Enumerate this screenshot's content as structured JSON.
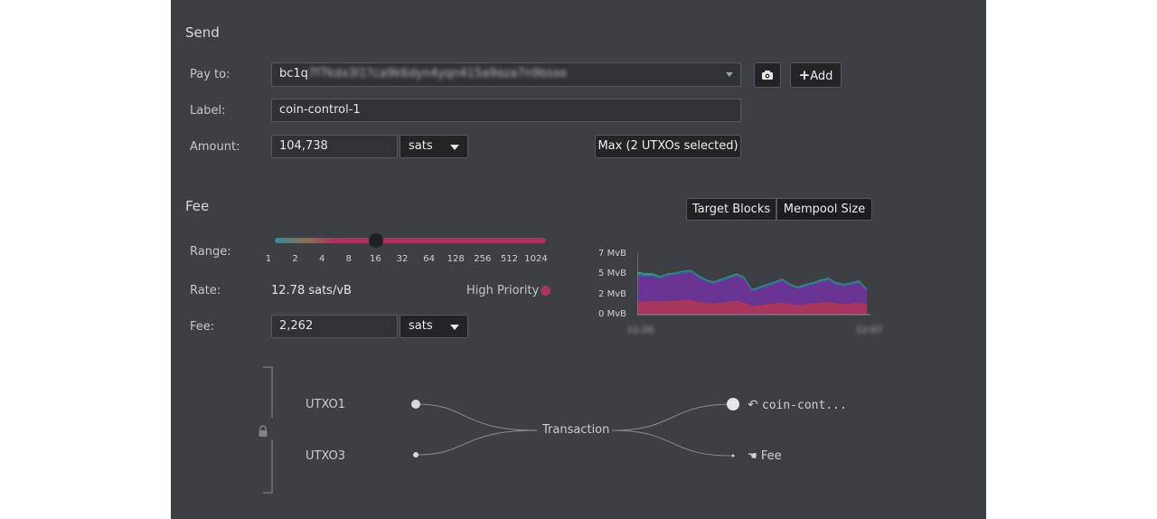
{
  "send": {
    "title": "Send",
    "pay_to_label": "Pay to:",
    "pay_to_prefix": "bc1q",
    "pay_to_obscured": "7f7kdx3l1?ca9k6dyn4yqn415a9aza7n9bsxe",
    "add_label": "Add",
    "label_label": "Label:",
    "label_value": "coin-control-1",
    "amount_label": "Amount:",
    "amount_value": "104,738",
    "amount_unit": "sats",
    "max_label": "Max (2 UTXOs selected)"
  },
  "fee": {
    "title": "Fee",
    "range_label": "Range:",
    "ticks": [
      "1",
      "2",
      "4",
      "8",
      "16",
      "32",
      "64",
      "128",
      "256",
      "512",
      "1024"
    ],
    "slider_position": 0.37,
    "rate_label": "Rate:",
    "rate_value": "12.78 sats/vB",
    "priority_label": "High Priority",
    "fee_label": "Fee:",
    "fee_value": "2,262",
    "fee_unit": "sats"
  },
  "chart_toggle": {
    "target_blocks": "Target Blocks",
    "mempool_size": "Mempool Size",
    "active": "mempool_size"
  },
  "chart_data": {
    "type": "area",
    "title": "",
    "xlabel": "",
    "ylabel": "",
    "y_ticks": [
      "7 MvB",
      "5 MvB",
      "2 MvB",
      "0 MvB"
    ],
    "ylim": [
      0,
      7
    ],
    "x_tick_labels_obscured": [
      "11:20",
      "12:07"
    ],
    "x": [
      0,
      1,
      2,
      3,
      4,
      5,
      6,
      7,
      8,
      9,
      10,
      11,
      12,
      13,
      14,
      15,
      16,
      17,
      18,
      19,
      20,
      21,
      22,
      23,
      24,
      25,
      26,
      27,
      28,
      29,
      30
    ],
    "series": [
      {
        "name": "",
        "color": "#a8355f",
        "values": [
          1.5,
          1.5,
          1.6,
          1.5,
          1.6,
          1.6,
          1.7,
          1.7,
          1.5,
          1.4,
          1.3,
          1.4,
          1.5,
          1.6,
          1.4,
          1.0,
          1.1,
          1.2,
          1.3,
          1.4,
          1.2,
          1.1,
          1.2,
          1.3,
          1.4,
          1.5,
          1.3,
          1.2,
          1.3,
          1.4,
          1.2
        ]
      },
      {
        "name": "",
        "color": "#6a3494",
        "values": [
          2.9,
          2.8,
          2.7,
          2.6,
          2.8,
          2.9,
          3.0,
          3.1,
          2.7,
          2.3,
          2.2,
          2.4,
          2.6,
          2.8,
          2.6,
          1.6,
          1.8,
          2.0,
          2.2,
          2.4,
          2.0,
          1.8,
          2.0,
          2.1,
          2.3,
          2.4,
          2.1,
          2.0,
          2.1,
          2.2,
          1.5
        ]
      },
      {
        "name": "",
        "color": "#3d62a8",
        "values": [
          0.3,
          0.2,
          0.2,
          0.2,
          0.2,
          0.2,
          0.2,
          0.2,
          0.2,
          0.2,
          0.2,
          0.2,
          0.2,
          0.2,
          0.2,
          0.2,
          0.2,
          0.2,
          0.2,
          0.2,
          0.2,
          0.2,
          0.2,
          0.2,
          0.2,
          0.2,
          0.2,
          0.2,
          0.2,
          0.2,
          0.2
        ]
      },
      {
        "name": "",
        "color": "#3aa07a",
        "values": [
          0.2,
          0.2,
          0.2,
          0.1,
          0.1,
          0.1,
          0.1,
          0.1,
          0.1,
          0.1,
          0.1,
          0.1,
          0.1,
          0.1,
          0.1,
          0.1,
          0.1,
          0.1,
          0.1,
          0.1,
          0.1,
          0.1,
          0.1,
          0.1,
          0.1,
          0.1,
          0.1,
          0.1,
          0.1,
          0.1,
          0.1
        ]
      }
    ]
  },
  "diagram": {
    "inputs": [
      "UTXO1",
      "UTXO3"
    ],
    "center": "Transaction",
    "outputs": [
      "coin-cont...",
      "Fee"
    ]
  },
  "colors": {
    "panel": "#3c3f43",
    "priority_dot": "#a8355f",
    "slider_track": "#a8355f"
  }
}
